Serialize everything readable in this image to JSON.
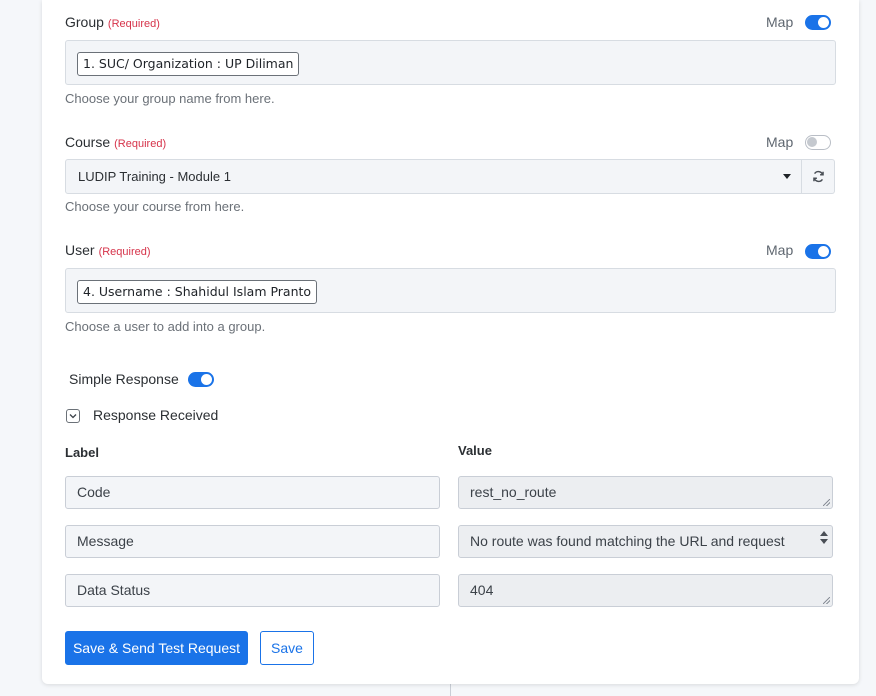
{
  "group": {
    "label": "Group",
    "required": "(Required)",
    "map_label": "Map",
    "map_on": true,
    "tag": "1. SUC/ Organization : UP Diliman",
    "help": "Choose your group name from here."
  },
  "course": {
    "label": "Course",
    "required": "(Required)",
    "map_label": "Map",
    "map_on": false,
    "selected": "LUDIP Training - Module 1",
    "help": "Choose your course from here.",
    "icons": {
      "dropdown": "caret-down-icon",
      "refresh": "refresh-icon"
    }
  },
  "user": {
    "label": "User",
    "required": "(Required)",
    "map_label": "Map",
    "map_on": true,
    "tag": "4. Username : Shahidul Islam Pranto",
    "help": "Choose a user to add into a group."
  },
  "simple_response": {
    "label": "Simple Response",
    "on": true
  },
  "response": {
    "label": "Response Received",
    "label_header": "Label",
    "value_header": "Value",
    "rows": [
      {
        "label": "Code",
        "value": "rest_no_route"
      },
      {
        "label": "Message",
        "value": "No route was found matching the URL and request"
      },
      {
        "label": "Data Status",
        "value": "404"
      }
    ]
  },
  "buttons": {
    "save_send": "Save & Send Test Request",
    "save": "Save"
  },
  "colors": {
    "accent": "#1a73e8",
    "required": "#d6334a"
  }
}
